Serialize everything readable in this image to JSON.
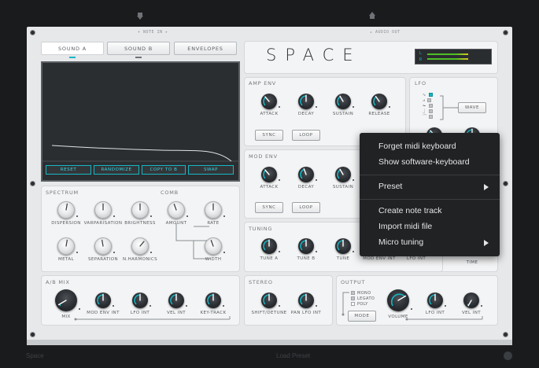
{
  "host": {
    "port_in": "▾ NOTE IN ▸",
    "port_out": "▴ AUDIO OUT",
    "footer_left": "Space",
    "footer_center": "Load Preset"
  },
  "header": {
    "title": "SPACE",
    "meter_labels": [
      "L",
      "R"
    ],
    "meter_levels": [
      0.8,
      0.8
    ]
  },
  "tabs": [
    {
      "label": "SOUND A",
      "active": true
    },
    {
      "label": "SOUND B",
      "active": false
    },
    {
      "label": "ENVELOPES",
      "active": false
    }
  ],
  "display_buttons": [
    "RESET",
    "RANDOMIZE",
    "COPY TO B",
    "SWAP"
  ],
  "spectrum": {
    "title": "SPECTRUM",
    "knobs": [
      "DISPERSION",
      "VARPARISATION",
      "BRIGHTNESS",
      "METAL",
      "SEPARATION",
      "N.HARMONICS"
    ],
    "comb_title": "COMB",
    "comb_knobs": [
      "AMOUNT",
      "RATE",
      "WIDTH"
    ]
  },
  "amp_env": {
    "title": "AMP ENV",
    "knobs": [
      "ATTACK",
      "DECAY",
      "SUSTAIN",
      "RELEASE"
    ],
    "buttons": [
      "SYNC",
      "LOOP"
    ]
  },
  "mod_env": {
    "title": "MOD ENV",
    "knobs": [
      "ATTACK",
      "DECAY",
      "SUSTAIN"
    ],
    "buttons": [
      "SYNC",
      "LOOP"
    ]
  },
  "lfo": {
    "title": "LFO",
    "shapes": [
      "∿",
      "⩘",
      "⏦",
      "⏌",
      "⏜"
    ],
    "wave_button": "WAVE",
    "time_label": "TIME"
  },
  "tuning": {
    "title": "TUNING",
    "knobs": [
      "TUNE A",
      "TUNE B",
      "TUNE",
      "MOD ENV INT",
      "LFO INT"
    ]
  },
  "ab_mix": {
    "title": "A/B MIX",
    "knobs": [
      "MIX",
      "MOD ENV INT",
      "LFO INT",
      "VEL INT",
      "KEY-TRACK"
    ]
  },
  "stereo": {
    "title": "STEREO",
    "knobs": [
      "SHIFT/DETUNE",
      "PAN LFO INT"
    ]
  },
  "output": {
    "title": "OUTPUT",
    "modes": [
      "MONO",
      "LEGATO",
      "POLY"
    ],
    "mode_button": "MODE",
    "knobs": [
      "VOLUME",
      "LFO INT",
      "VEL INT"
    ]
  },
  "context_menu": {
    "items": [
      "Forget midi keyboard",
      "Show software-keyboard",
      "Preset",
      "Create note track",
      "Import midi file",
      "Micro tuning"
    ]
  },
  "colors": {
    "accent": "#16b7c6",
    "meter_green": "#4fbf26",
    "meter_yellow": "#e3c41c"
  }
}
